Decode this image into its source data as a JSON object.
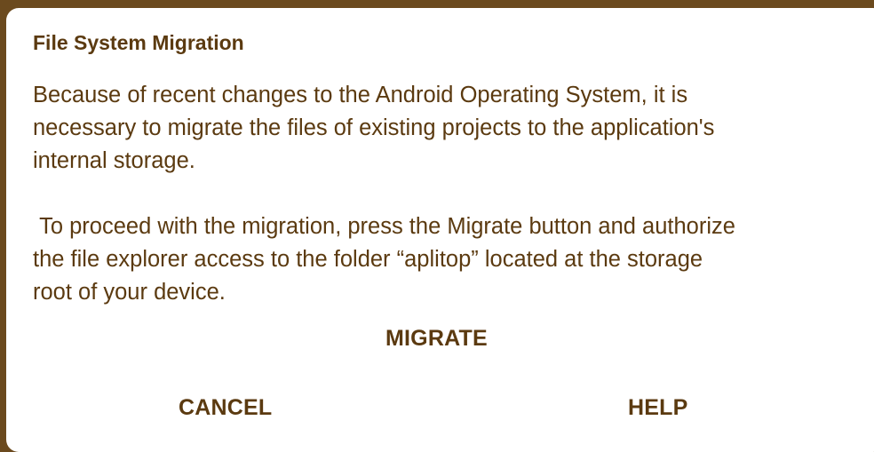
{
  "dialog": {
    "title": "File System Migration",
    "message": "Because of recent changes to the Android Operating System, it is\nnecessary to migrate the files of existing projects to the application's\ninternal storage.\n\n To proceed with the migration, press the Migrate button and authorize\nthe file explorer access to the folder “aplitop” located at the storage\nroot of your device.",
    "buttons": {
      "migrate": "MIGRATE",
      "cancel": "CANCEL",
      "help": "HELP"
    }
  },
  "colors": {
    "text": "#5b3a10",
    "frame": "#6b4a1e",
    "background": "#ffffff"
  }
}
